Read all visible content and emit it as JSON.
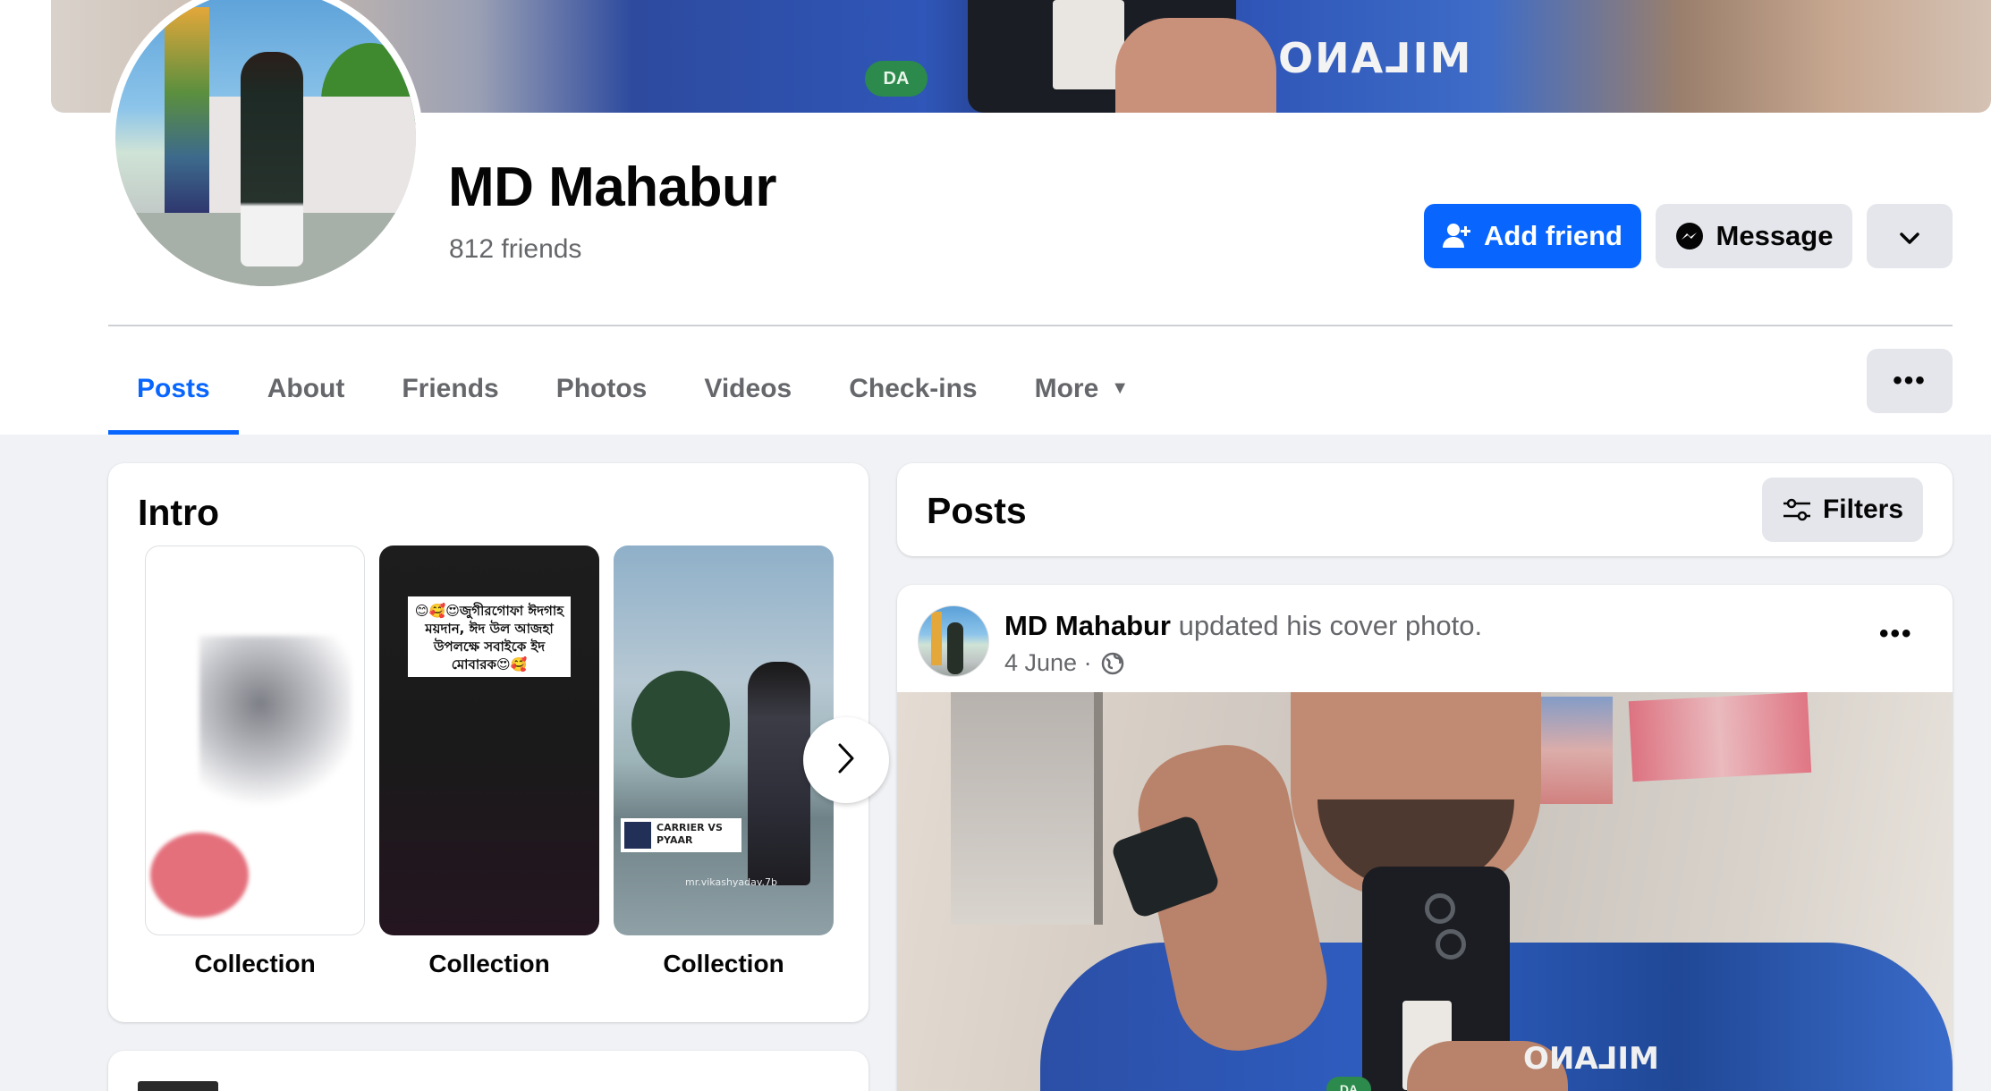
{
  "profile": {
    "name": "MD Mahabur",
    "friends_count": "812 friends"
  },
  "cover": {
    "shirt_logo": "MILANO",
    "badge": "DA"
  },
  "actions": {
    "add_friend": "Add friend",
    "message": "Message",
    "more_icon": "chevron-down-icon"
  },
  "tabs": [
    {
      "label": "Posts",
      "active": true
    },
    {
      "label": "About"
    },
    {
      "label": "Friends"
    },
    {
      "label": "Photos"
    },
    {
      "label": "Videos"
    },
    {
      "label": "Check-ins"
    },
    {
      "label": "More",
      "caret": "▼"
    }
  ],
  "tabs_overflow": "•••",
  "intro": {
    "title": "Intro",
    "collections": [
      {
        "caption": "Collection"
      },
      {
        "caption": "Collection",
        "overlay_text": "😊🥰😍জুগীরগোফা ঈদগাহ ময়দান, ঈদ উল আজহা উপলক্ষে সবাইকে ইদ মোবারক😍🥰"
      },
      {
        "caption": "Collection",
        "overlay_label": "CARRIER VS PYAAR",
        "watermark": "mr.vikashyadav.7b"
      }
    ]
  },
  "posts_section": {
    "title": "Posts",
    "filters_label": "Filters"
  },
  "post": {
    "author": "MD Mahabur",
    "action": " updated his cover photo.",
    "date": "4 June ·",
    "privacy_icon": "globe-icon",
    "menu": "•••",
    "image_logo": "MILANO",
    "image_badge": "DA"
  },
  "colors": {
    "brand_blue": "#0866ff",
    "secondary_button": "#e4e6eb",
    "page_background": "#f0f2f5",
    "muted_text": "#65676b"
  }
}
